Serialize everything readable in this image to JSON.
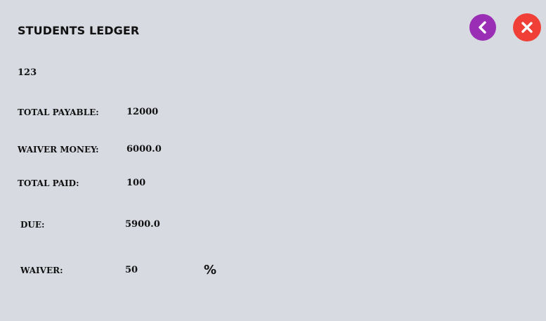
{
  "header": {
    "title": "STUDENTS LEDGER"
  },
  "student": {
    "id": "123"
  },
  "ledger": {
    "total_payable_label": "TOTAL PAYABLE:",
    "total_payable_value": "12000",
    "waiver_money_label": "WAIVER MONEY:",
    "waiver_money_value": "6000.0",
    "total_paid_label": "TOTAL PAID:",
    "total_paid_value": "100",
    "due_label": "DUE:",
    "due_value": "5900.0",
    "waiver_label": "WAIVER:",
    "waiver_value": "50",
    "waiver_unit": "%"
  },
  "buttons": {
    "back_icon": "chevron-left-icon",
    "back_color": "#9a2fb5",
    "close_icon": "close-icon",
    "close_color": "#ef3f37"
  }
}
